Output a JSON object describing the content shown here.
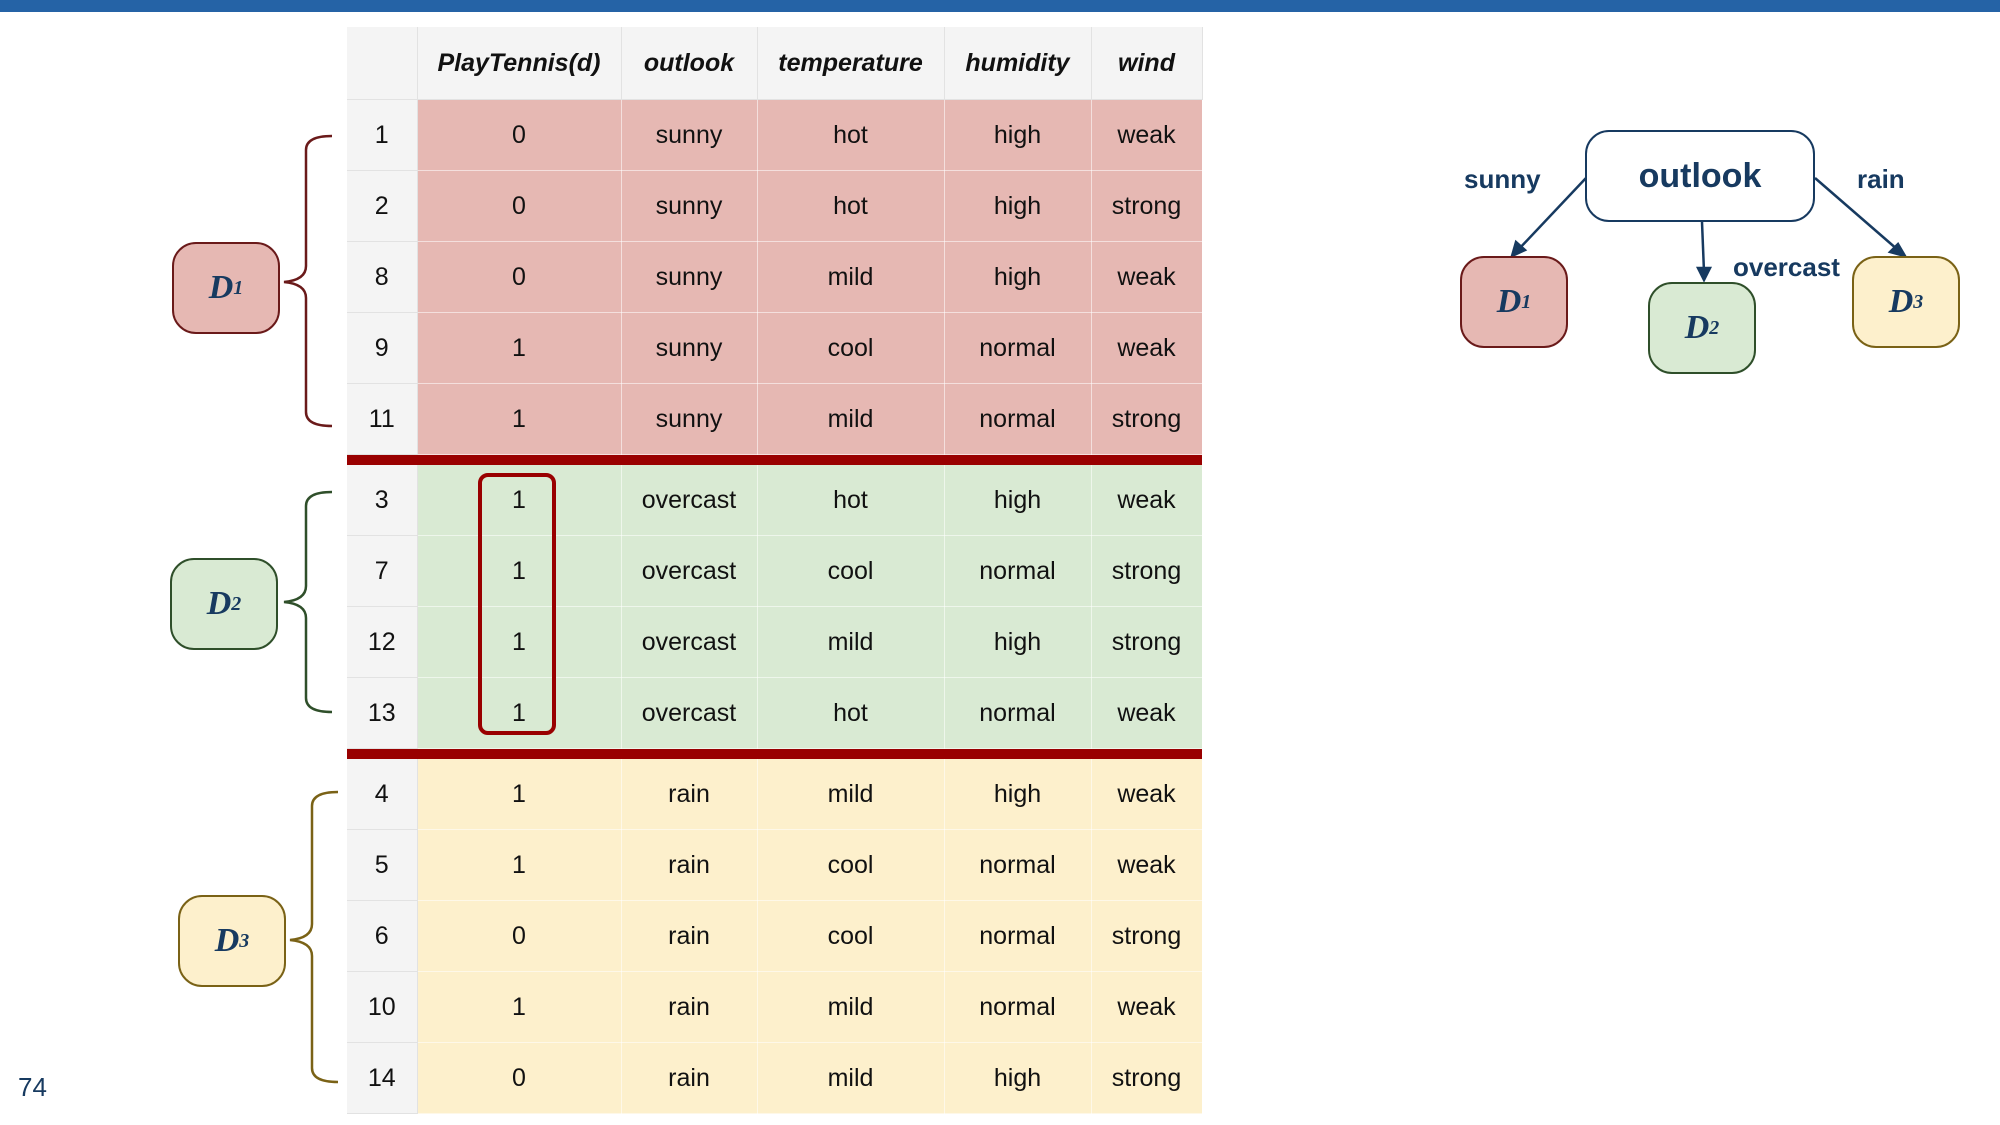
{
  "table": {
    "headers": [
      "",
      "PlayTennis(d)",
      "outlook",
      "temperature",
      "humidity",
      "wind"
    ],
    "groups": [
      {
        "rows": [
          [
            "1",
            "0",
            "sunny",
            "hot",
            "high",
            "weak"
          ],
          [
            "2",
            "0",
            "sunny",
            "hot",
            "high",
            "strong"
          ],
          [
            "8",
            "0",
            "sunny",
            "mild",
            "high",
            "weak"
          ],
          [
            "9",
            "1",
            "sunny",
            "cool",
            "normal",
            "weak"
          ],
          [
            "11",
            "1",
            "sunny",
            "mild",
            "normal",
            "strong"
          ]
        ]
      },
      {
        "rows": [
          [
            "3",
            "1",
            "overcast",
            "hot",
            "high",
            "weak"
          ],
          [
            "7",
            "1",
            "overcast",
            "cool",
            "normal",
            "strong"
          ],
          [
            "12",
            "1",
            "overcast",
            "mild",
            "high",
            "strong"
          ],
          [
            "13",
            "1",
            "overcast",
            "hot",
            "normal",
            "weak"
          ]
        ]
      },
      {
        "rows": [
          [
            "4",
            "1",
            "rain",
            "mild",
            "high",
            "weak"
          ],
          [
            "5",
            "1",
            "rain",
            "cool",
            "normal",
            "weak"
          ],
          [
            "6",
            "0",
            "rain",
            "cool",
            "normal",
            "strong"
          ],
          [
            "10",
            "1",
            "rain",
            "mild",
            "normal",
            "weak"
          ],
          [
            "14",
            "0",
            "rain",
            "mild",
            "high",
            "strong"
          ]
        ]
      }
    ]
  },
  "group_labels": [
    {
      "letter": "D",
      "sub": "1"
    },
    {
      "letter": "D",
      "sub": "2"
    },
    {
      "letter": "D",
      "sub": "3"
    }
  ],
  "tree": {
    "root": "outlook",
    "edges": [
      "sunny",
      "overcast",
      "rain"
    ]
  },
  "page_number": "74",
  "colors": {
    "d1_fill": "#e6b8b3",
    "d2_fill": "#d9ead3",
    "d3_fill": "#fdf0cc",
    "separator": "#990000",
    "accent": "#173a60",
    "top_bar": "#2563a6"
  }
}
